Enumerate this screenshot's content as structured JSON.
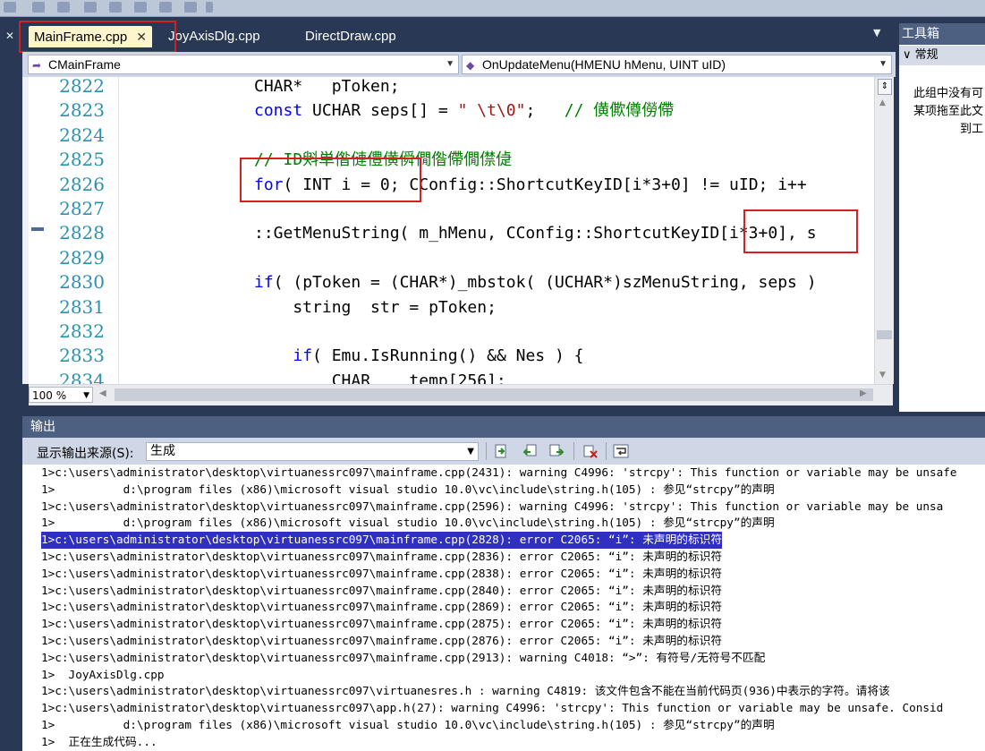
{
  "tabs": [
    {
      "label": "MainFrame.cpp",
      "active": true
    },
    {
      "label": "JoyAxisDlg.cpp",
      "active": false
    },
    {
      "label": "DirectDraw.cpp",
      "active": false
    }
  ],
  "tab_close": "✕",
  "tabs_dropdown": "▼",
  "left_close": "✕",
  "nav": {
    "class_selector": "CMainFrame",
    "method_selector": "OnUpdateMenu(HMENU hMenu, UINT uID)"
  },
  "editor": {
    "line_numbers": [
      "2822",
      "2823",
      "2824",
      "2825",
      "2826",
      "2827",
      "2828",
      "2829",
      "2830",
      "2831",
      "2832",
      "2833",
      "2834"
    ],
    "lines": [
      [
        {
          "t": "CHAR*   pToken;",
          "c": ""
        }
      ],
      [
        {
          "t": "const",
          "c": "kw"
        },
        {
          "t": " UCHAR seps[] = ",
          "c": ""
        },
        {
          "t": "\" \\t\\0\"",
          "c": "st"
        },
        {
          "t": ";   ",
          "c": ""
        },
        {
          "t": "// 僙僛僔僗僀",
          "c": "cm"
        }
      ],
      [],
      [
        {
          "t": "// ID斞単偺僆僼僙僢僩偺僀僩僸偼",
          "c": "cm"
        }
      ],
      [
        {
          "t": "for",
          "c": "kw"
        },
        {
          "t": "( INT i = 0; CConfig::ShortcutKeyID[i*3+0] != uID; i++",
          "c": ""
        }
      ],
      [],
      [
        {
          "t": "::GetMenuString( m_hMenu, CConfig::ShortcutKeyID[i*3+0], s",
          "c": ""
        }
      ],
      [],
      [
        {
          "t": "if",
          "c": "kw"
        },
        {
          "t": "( (pToken = (CHAR*)_mbstok( (UCHAR*)szMenuString, seps )",
          "c": ""
        }
      ],
      [
        {
          "t": "    string  str = pToken;",
          "c": ""
        }
      ],
      [],
      [
        {
          "t": "    ",
          "c": ""
        },
        {
          "t": "if",
          "c": "kw"
        },
        {
          "t": "( Emu.IsRunning() && Nes ) {",
          "c": ""
        }
      ],
      [
        {
          "t": "        CHAR    temp[256];",
          "c": ""
        }
      ]
    ],
    "zoom": "100 %"
  },
  "toolbox": {
    "title": "工具箱",
    "group": "常规",
    "empty_lines": [
      "此组中没有可",
      "某项拖至此文",
      "到工"
    ]
  },
  "output": {
    "title": "输出",
    "source_label": "显示输出来源(S):",
    "source_value": "生成",
    "lines": [
      "1>c:\\users\\administrator\\desktop\\virtuanessrc097\\mainframe.cpp(2431): warning C4996: 'strcpy': This function or variable may be unsafe",
      "1>          d:\\program files (x86)\\microsoft visual studio 10.0\\vc\\include\\string.h(105) : 参见“strcpy”的声明",
      "1>c:\\users\\administrator\\desktop\\virtuanessrc097\\mainframe.cpp(2596): warning C4996: 'strcpy': This function or variable may be unsa",
      "1>          d:\\program files (x86)\\microsoft visual studio 10.0\\vc\\include\\string.h(105) : 参见“strcpy”的声明",
      "1>c:\\users\\administrator\\desktop\\virtuanessrc097\\mainframe.cpp(2828): error C2065: “i”: 未声明的标识符",
      "1>c:\\users\\administrator\\desktop\\virtuanessrc097\\mainframe.cpp(2836): error C2065: “i”: 未声明的标识符",
      "1>c:\\users\\administrator\\desktop\\virtuanessrc097\\mainframe.cpp(2838): error C2065: “i”: 未声明的标识符",
      "1>c:\\users\\administrator\\desktop\\virtuanessrc097\\mainframe.cpp(2840): error C2065: “i”: 未声明的标识符",
      "1>c:\\users\\administrator\\desktop\\virtuanessrc097\\mainframe.cpp(2869): error C2065: “i”: 未声明的标识符",
      "1>c:\\users\\administrator\\desktop\\virtuanessrc097\\mainframe.cpp(2875): error C2065: “i”: 未声明的标识符",
      "1>c:\\users\\administrator\\desktop\\virtuanessrc097\\mainframe.cpp(2876): error C2065: “i”: 未声明的标识符",
      "1>c:\\users\\administrator\\desktop\\virtuanessrc097\\mainframe.cpp(2913): warning C4018: “>”: 有符号/无符号不匹配",
      "1>  JoyAxisDlg.cpp",
      "1>c:\\users\\administrator\\desktop\\virtuanessrc097\\virtuanesres.h : warning C4819: 该文件包含不能在当前代码页(936)中表示的字符。请将该",
      "1>c:\\users\\administrator\\desktop\\virtuanessrc097\\app.h(27): warning C4996: 'strcpy': This function or variable may be unsafe. Consid",
      "1>          d:\\program files (x86)\\microsoft visual studio 10.0\\vc\\include\\string.h(105) : 参见“strcpy”的声明",
      "1>  正在生成代码..."
    ],
    "selected_index": 4
  },
  "colors": {
    "chrome_dark": "#293955",
    "active_tab": "#fff5cc",
    "line_number": "#2b91af",
    "keyword": "#0000ff",
    "comment": "#008000",
    "highlight_box": "#d42020",
    "selection": "#3030c0"
  }
}
